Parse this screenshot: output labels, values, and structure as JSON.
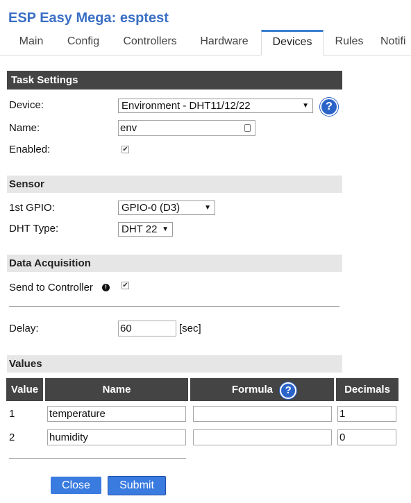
{
  "header": {
    "title": "ESP Easy Mega: esptest"
  },
  "tabs": [
    {
      "label": "Main"
    },
    {
      "label": "Config"
    },
    {
      "label": "Controllers"
    },
    {
      "label": "Hardware"
    },
    {
      "label": "Devices",
      "active": true
    },
    {
      "label": "Rules"
    },
    {
      "label": "Notifi"
    }
  ],
  "task_settings": {
    "header": "Task Settings",
    "device_label": "Device:",
    "device_value": "Environment - DHT11/12/22",
    "name_label": "Name:",
    "name_value": "env",
    "enabled_label": "Enabled:",
    "enabled_checked": true
  },
  "sensor": {
    "header": "Sensor",
    "gpio_label": "1st GPIO:",
    "gpio_value": "GPIO-0 (D3)",
    "dht_label": "DHT Type:",
    "dht_value": "DHT 22"
  },
  "data_acquisition": {
    "header": "Data Acquisition",
    "send_label": "Send to Controller",
    "send_checked": true,
    "info_glyph": "!",
    "delay_label": "Delay:",
    "delay_value": "60",
    "delay_unit": "[sec]"
  },
  "values": {
    "header": "Values",
    "columns": [
      "Value",
      "Name",
      "Formula",
      "Decimals"
    ],
    "rows": [
      {
        "index": "1",
        "name": "temperature",
        "formula": "",
        "decimals": "1"
      },
      {
        "index": "2",
        "name": "humidity",
        "formula": "",
        "decimals": "0"
      }
    ]
  },
  "buttons": {
    "close": "Close",
    "submit": "Submit"
  },
  "icons": {
    "help": "?",
    "checkmark": "✔",
    "dropdown": "▼"
  },
  "colors": {
    "title": "#3a6fc4",
    "accent": "#3b7fd0",
    "button": "#3a7be0",
    "header_dark": "#444444"
  }
}
